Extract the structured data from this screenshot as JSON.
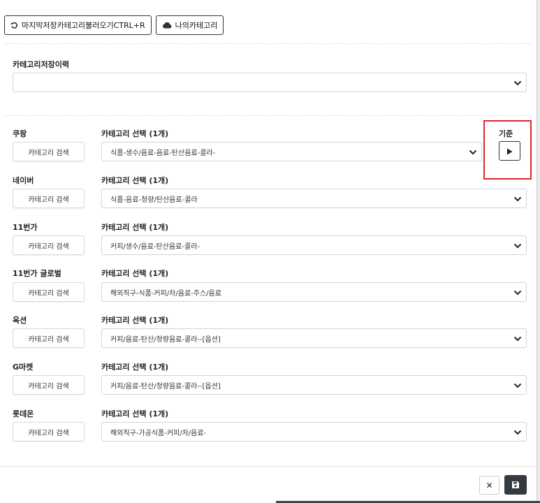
{
  "toolbar": {
    "load_last_label": "마지막저장카테고리불러오기CTRL+R",
    "my_category_label": "나의카테고리"
  },
  "history": {
    "label": "카테고리저장이력",
    "value": ""
  },
  "standard_label": "기준",
  "search_button_label": "카테고리 검색",
  "select_label": "카테고리 선택 (1개)",
  "markets": [
    {
      "name": "쿠팡",
      "category": "식품-생수/음료-음료-탄산음료-콜라-"
    },
    {
      "name": "네이버",
      "category": "식품-음료-청량/탄산음료-콜라"
    },
    {
      "name": "11번가",
      "category": "커피/생수/음료-탄산음료-콜라-"
    },
    {
      "name": "11번가 글로벌",
      "category": "해외직구-식품-커피/차/음료-주스/음료"
    },
    {
      "name": "옥션",
      "category": "커피/음료-탄산/청량음료-콜라--[옵션]"
    },
    {
      "name": "G마켓",
      "category": "커피/음료-탄산/청량음료-콜라--[옵션]"
    },
    {
      "name": "롯데온",
      "category": "해외직구-가공식품-커피/차/음료-"
    }
  ],
  "footer": {
    "close_symbol": "✕"
  },
  "colors": {
    "highlight": "#e0242b",
    "save_button": "#343a40"
  }
}
